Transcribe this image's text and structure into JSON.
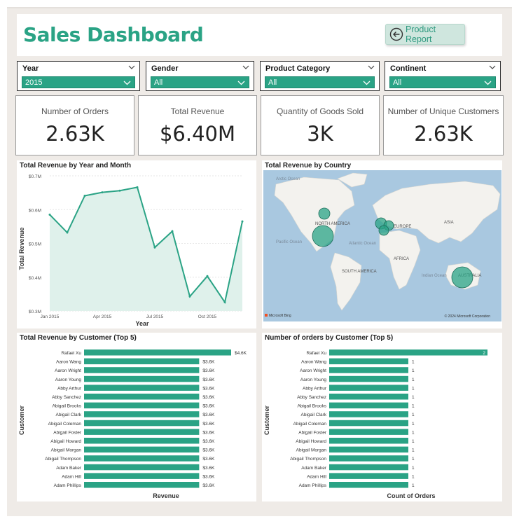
{
  "header": {
    "title": "Sales Dashboard",
    "nav_button_label": "Product Report"
  },
  "slicers": [
    {
      "label": "Year",
      "value": "2015"
    },
    {
      "label": "Gender",
      "value": "All"
    },
    {
      "label": "Product Category",
      "value": "All"
    },
    {
      "label": "Continent",
      "value": "All"
    }
  ],
  "kpis": [
    {
      "label": "Number of Orders",
      "value": "2.63K"
    },
    {
      "label": "Total Revenue",
      "value": "$6.40M"
    },
    {
      "label": "Quantity of Goods Sold",
      "value": "3K"
    },
    {
      "label": "Number of Unique Customers",
      "value": "2.63K"
    }
  ],
  "colors": {
    "accent": "#2aa385",
    "area_fill": "#dff1eb",
    "background": "#efebe7"
  },
  "map": {
    "title": "Total Revenue by Country",
    "labels": [
      "Arctic Ocean",
      "NORTH AMERICA",
      "EUROPE",
      "ASIA",
      "Pacific Ocean",
      "Atlantic Ocean",
      "AFRICA",
      "SOUTH AMERICA",
      "Indian Ocean",
      "AUSTRALIA"
    ],
    "provider": "Microsoft Bing",
    "copyright": "© 2024 Microsoft Corporation"
  },
  "chart_data": [
    {
      "type": "area",
      "title": "Total Revenue by Year and Month",
      "xlabel": "Year",
      "ylabel": "Total Revenue",
      "x_ticks": [
        "Jan 2015",
        "Apr 2015",
        "Jul 2015",
        "Oct 2015"
      ],
      "y_ticks": [
        "$0.3M",
        "$0.4M",
        "$0.5M",
        "$0.6M",
        "$0.7M"
      ],
      "ylim": [
        0.3,
        0.7
      ],
      "x": [
        "2015-01",
        "2015-02",
        "2015-03",
        "2015-04",
        "2015-05",
        "2015-06",
        "2015-07",
        "2015-08",
        "2015-09",
        "2015-10",
        "2015-11",
        "2015-12"
      ],
      "values": [
        0.585,
        0.532,
        0.641,
        0.651,
        0.656,
        0.666,
        0.488,
        0.536,
        0.343,
        0.403,
        0.326,
        0.565
      ]
    },
    {
      "type": "bar",
      "title": "Total Revenue by Customer (Top 5)",
      "xlabel": "Revenue",
      "ylabel": "Customer",
      "categories": [
        "Rafael Xu",
        "Aaron Wang",
        "Aaron Wright",
        "Aaron Young",
        "Abby Arthur",
        "Abby Sanchez",
        "Abigail Brooks",
        "Abigail Clark",
        "Abigail Coleman",
        "Abigail Foster",
        "Abigail Howard",
        "Abigail Morgan",
        "Abigail Thompson",
        "Adam Baker",
        "Adam Hill",
        "Adam Phillips"
      ],
      "values": [
        4.6,
        3.6,
        3.6,
        3.6,
        3.6,
        3.6,
        3.6,
        3.6,
        3.6,
        3.6,
        3.6,
        3.6,
        3.6,
        3.6,
        3.6,
        3.6
      ],
      "data_labels": [
        "$4.6K",
        "$3.6K",
        "$3.6K",
        "$3.6K",
        "$3.6K",
        "$3.6K",
        "$3.6K",
        "$3.6K",
        "$3.6K",
        "$3.6K",
        "$3.6K",
        "$3.6K",
        "$3.6K",
        "$3.6K",
        "$3.6K",
        "$3.6K"
      ]
    },
    {
      "type": "bar",
      "title": "Number of orders by Customer (Top 5)",
      "xlabel": "Count of Orders",
      "ylabel": "Customer",
      "categories": [
        "Rafael Xu",
        "Aaron Wang",
        "Aaron Wright",
        "Aaron Young",
        "Abby Arthur",
        "Abby Sanchez",
        "Abigail Brooks",
        "Abigail Clark",
        "Abigail Coleman",
        "Abigail Foster",
        "Abigail Howard",
        "Abigail Morgan",
        "Abigail Thompson",
        "Adam Baker",
        "Adam Hill",
        "Adam Phillips"
      ],
      "values": [
        2,
        1,
        1,
        1,
        1,
        1,
        1,
        1,
        1,
        1,
        1,
        1,
        1,
        1,
        1,
        1
      ],
      "data_labels": [
        "2",
        "1",
        "1",
        "1",
        "1",
        "1",
        "1",
        "1",
        "1",
        "1",
        "1",
        "1",
        "1",
        "1",
        "1",
        "1"
      ]
    }
  ]
}
